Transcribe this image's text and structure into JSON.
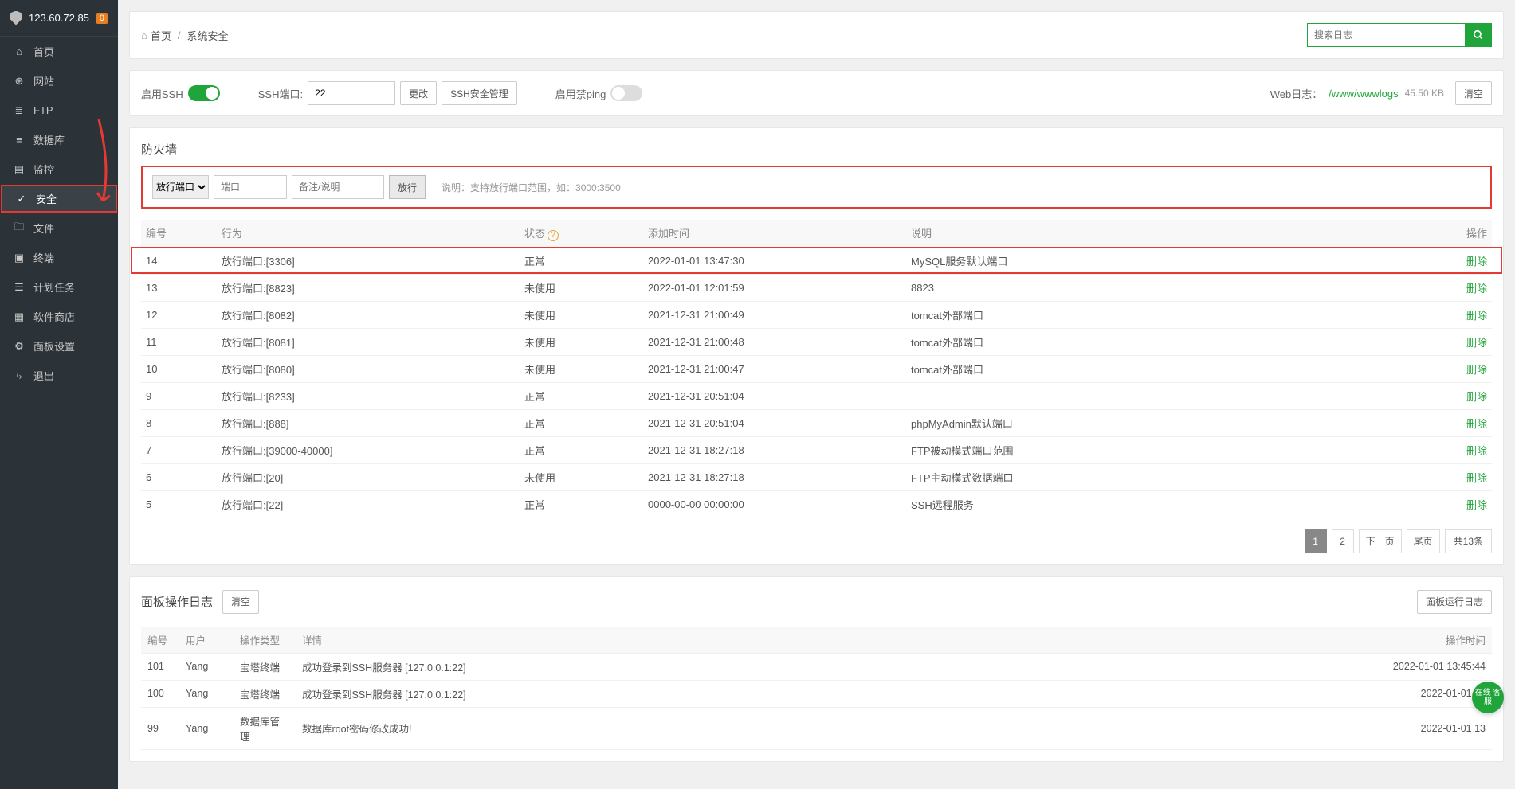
{
  "header": {
    "ip": "123.60.72.85",
    "badge": "0"
  },
  "sidebar": {
    "items": [
      {
        "icon": "home",
        "label": "首页"
      },
      {
        "icon": "site",
        "label": "网站"
      },
      {
        "icon": "ftp",
        "label": "FTP"
      },
      {
        "icon": "db",
        "label": "数据库"
      },
      {
        "icon": "monitor",
        "label": "监控"
      },
      {
        "icon": "security",
        "label": "安全"
      },
      {
        "icon": "file",
        "label": "文件"
      },
      {
        "icon": "terminal",
        "label": "终端"
      },
      {
        "icon": "cron",
        "label": "计划任务"
      },
      {
        "icon": "store",
        "label": "软件商店"
      },
      {
        "icon": "settings",
        "label": "面板设置"
      },
      {
        "icon": "exit",
        "label": "退出"
      }
    ],
    "activeIndex": 5
  },
  "breadcrumb": {
    "home": "首页",
    "current": "系统安全"
  },
  "search": {
    "placeholder": "搜索日志"
  },
  "ssh": {
    "enable_label": "启用SSH",
    "port_label": "SSH端口:",
    "port_value": "22",
    "change_btn": "更改",
    "manage_btn": "SSH安全管理",
    "ban_ping_label": "启用禁ping",
    "weblog_label": "Web日志：",
    "weblog_path": "/www/wwwlogs",
    "weblog_size": "45.50 KB",
    "clear_btn": "清空"
  },
  "firewall": {
    "title": "防火墙",
    "mode_options": [
      "放行端口"
    ],
    "port_placeholder": "端口",
    "remark_placeholder": "备注/说明",
    "go_btn": "放行",
    "hint": "说明：支持放行端口范围，如：3000:3500",
    "columns": {
      "id": "编号",
      "action": "行为",
      "status": "状态",
      "addtime": "添加时间",
      "desc": "说明",
      "op": "操作"
    },
    "op_delete": "删除",
    "rows": [
      {
        "id": "14",
        "action": "放行端口:[3306]",
        "status": "正常",
        "addtime": "2022-01-01 13:47:30",
        "desc": "MySQL服务默认端口",
        "hl": true
      },
      {
        "id": "13",
        "action": "放行端口:[8823]",
        "status": "未使用",
        "addtime": "2022-01-01 12:01:59",
        "desc": "8823"
      },
      {
        "id": "12",
        "action": "放行端口:[8082]",
        "status": "未使用",
        "addtime": "2021-12-31 21:00:49",
        "desc": "tomcat外部端口"
      },
      {
        "id": "11",
        "action": "放行端口:[8081]",
        "status": "未使用",
        "addtime": "2021-12-31 21:00:48",
        "desc": "tomcat外部端口"
      },
      {
        "id": "10",
        "action": "放行端口:[8080]",
        "status": "未使用",
        "addtime": "2021-12-31 21:00:47",
        "desc": "tomcat外部端口"
      },
      {
        "id": "9",
        "action": "放行端口:[8233]",
        "status": "正常",
        "addtime": "2021-12-31 20:51:04",
        "desc": ""
      },
      {
        "id": "8",
        "action": "放行端口:[888]",
        "status": "正常",
        "addtime": "2021-12-31 20:51:04",
        "desc": "phpMyAdmin默认端口"
      },
      {
        "id": "7",
        "action": "放行端口:[39000-40000]",
        "status": "正常",
        "addtime": "2021-12-31 18:27:18",
        "desc": "FTP被动模式端口范围"
      },
      {
        "id": "6",
        "action": "放行端口:[20]",
        "status": "未使用",
        "addtime": "2021-12-31 18:27:18",
        "desc": "FTP主动模式数据端口"
      },
      {
        "id": "5",
        "action": "放行端口:[22]",
        "status": "正常",
        "addtime": "0000-00-00 00:00:00",
        "desc": "SSH远程服务"
      }
    ],
    "pager": {
      "pages": [
        "1",
        "2"
      ],
      "next": "下一页",
      "last": "尾页",
      "total": "共13条",
      "active": 0
    }
  },
  "logs": {
    "title": "面板操作日志",
    "clear_btn": "清空",
    "runlog_btn": "面板运行日志",
    "columns": {
      "id": "编号",
      "user": "用户",
      "type": "操作类型",
      "detail": "详情",
      "time": "操作时间"
    },
    "rows": [
      {
        "id": "101",
        "user": "Yang",
        "type": "宝塔终端",
        "detail": "成功登录到SSH服务器 [127.0.0.1:22]",
        "time": "2022-01-01 13:45:44"
      },
      {
        "id": "100",
        "user": "Yang",
        "type": "宝塔终端",
        "detail": "成功登录到SSH服务器 [127.0.0.1:22]",
        "time": "2022-01-01 13"
      },
      {
        "id": "99",
        "user": "Yang",
        "type": "数据库管理",
        "detail": "数据库root密码修改成功!",
        "time": "2022-01-01 13"
      }
    ]
  },
  "bubble": "在线\n客服"
}
